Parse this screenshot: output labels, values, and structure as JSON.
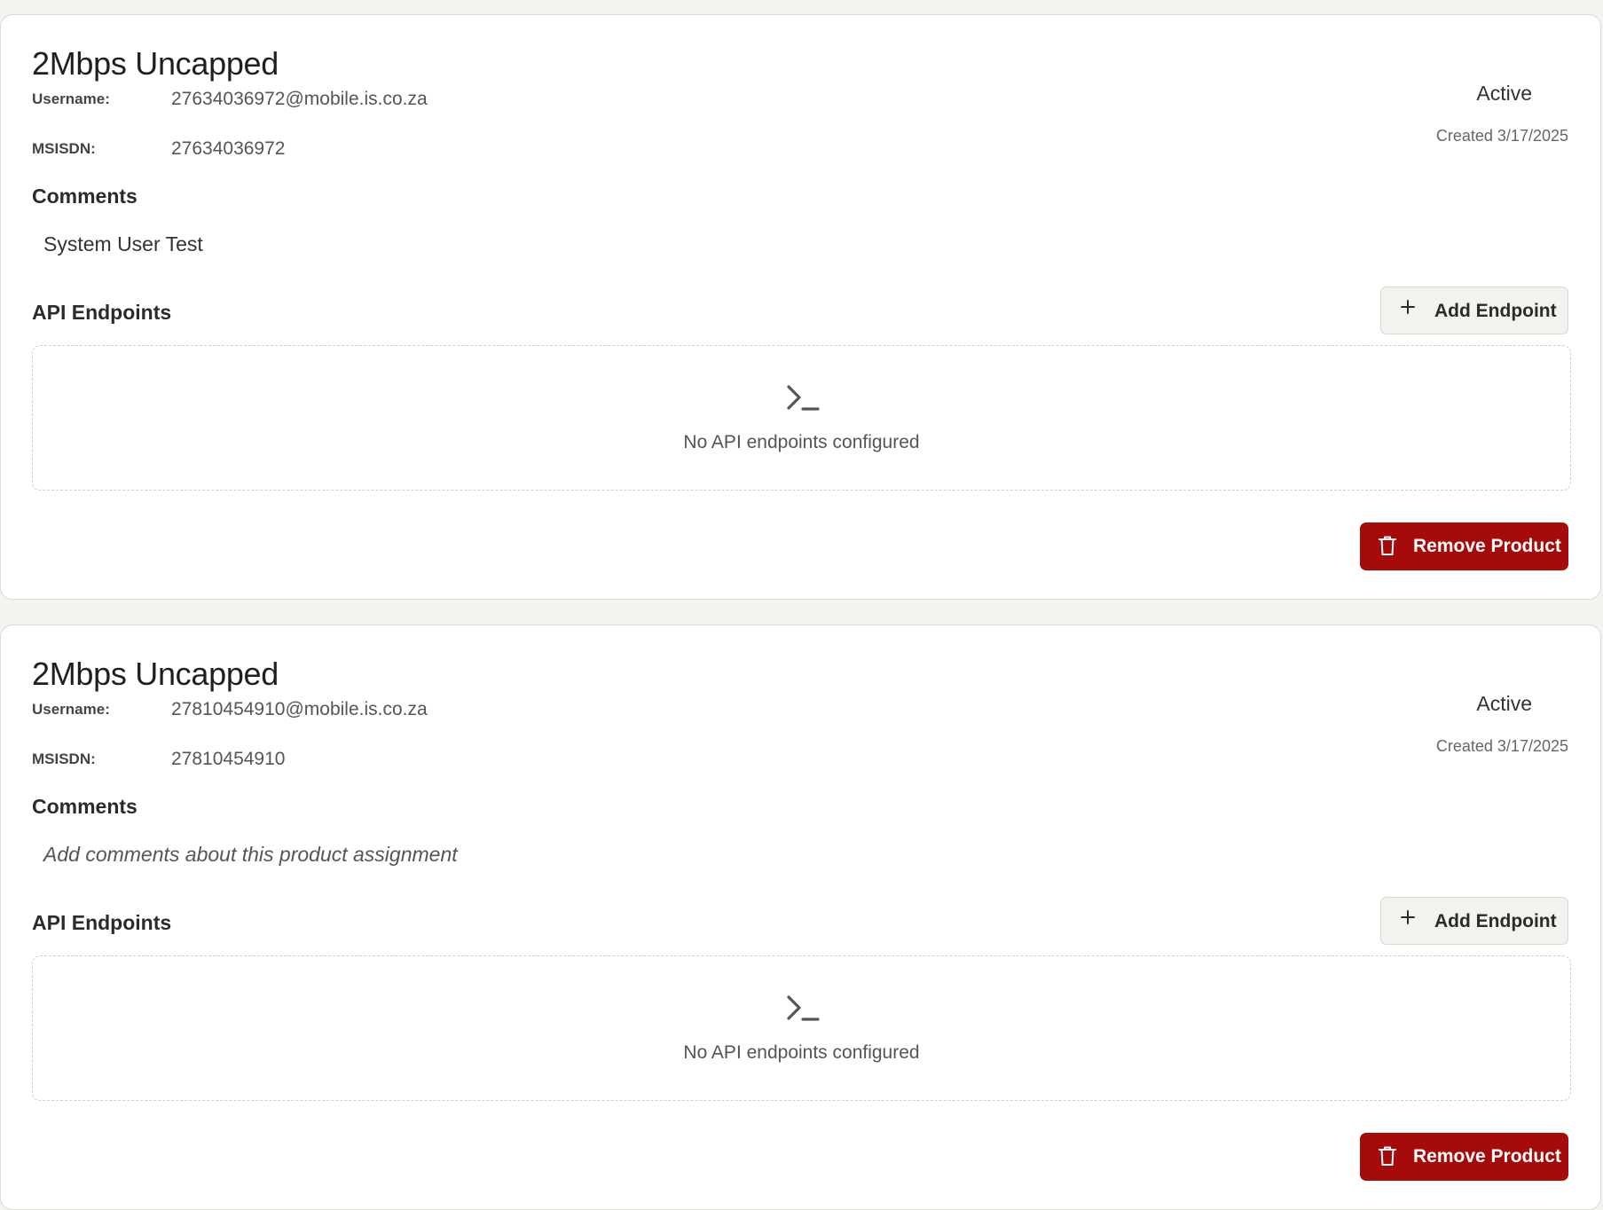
{
  "colors": {
    "background": "#f4f3ef",
    "card": "#ffffff",
    "danger": "#a50b0b",
    "secondary_button": "#f3f2ee"
  },
  "products": [
    {
      "title": "2Mbps Uncapped",
      "username_label": "Username:",
      "username": "27634036972@mobile.is.co.za",
      "msisdn_label": "MSISDN:",
      "msisdn": "27634036972",
      "status": "Active",
      "created_prefix": "Created",
      "created_date": "3/17/2025",
      "comments_heading": "Comments",
      "comment": "System User Test",
      "comment_placeholder": "",
      "api_heading": "API Endpoints",
      "add_endpoint_label": "Add Endpoint",
      "add_endpoint_icon": "plus-icon",
      "empty_icon": "terminal-icon",
      "empty_endpoints_text": "No API endpoints configured",
      "remove_label": "Remove Product",
      "remove_icon": "trash-icon"
    },
    {
      "title": "2Mbps Uncapped",
      "username_label": "Username:",
      "username": "27810454910@mobile.is.co.za",
      "msisdn_label": "MSISDN:",
      "msisdn": "27810454910",
      "status": "Active",
      "created_prefix": "Created",
      "created_date": "3/17/2025",
      "comments_heading": "Comments",
      "comment": "",
      "comment_placeholder": "Add comments about this product assignment",
      "api_heading": "API Endpoints",
      "add_endpoint_label": "Add Endpoint",
      "add_endpoint_icon": "plus-icon",
      "empty_icon": "terminal-icon",
      "empty_endpoints_text": "No API endpoints configured",
      "remove_label": "Remove Product",
      "remove_icon": "trash-icon"
    }
  ]
}
